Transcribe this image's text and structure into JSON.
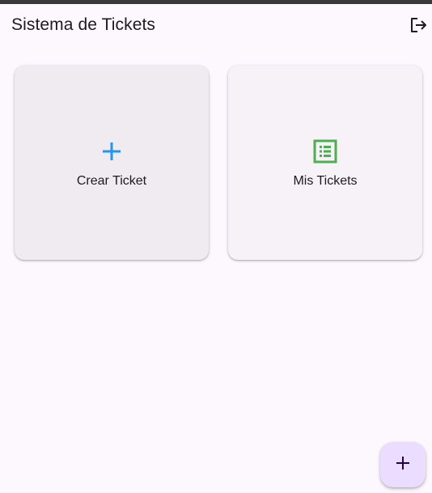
{
  "app_bar": {
    "title": "Sistema de Tickets",
    "actions": [
      {
        "name": "logout",
        "icon": "logout-icon"
      }
    ]
  },
  "dashboard": {
    "cards": [
      {
        "id": "create-ticket",
        "label": "Crear Ticket",
        "icon": "add-icon",
        "icon_color": "#2196f3"
      },
      {
        "id": "my-tickets",
        "label": "Mis Tickets",
        "icon": "list-alt-icon",
        "icon_color": "#4caf50"
      }
    ]
  },
  "fab": {
    "icon": "add-icon",
    "background": "#eaddff",
    "icon_color": "#21005d"
  },
  "colors": {
    "background": "#fdf7fe",
    "text": "#1d1b20"
  }
}
